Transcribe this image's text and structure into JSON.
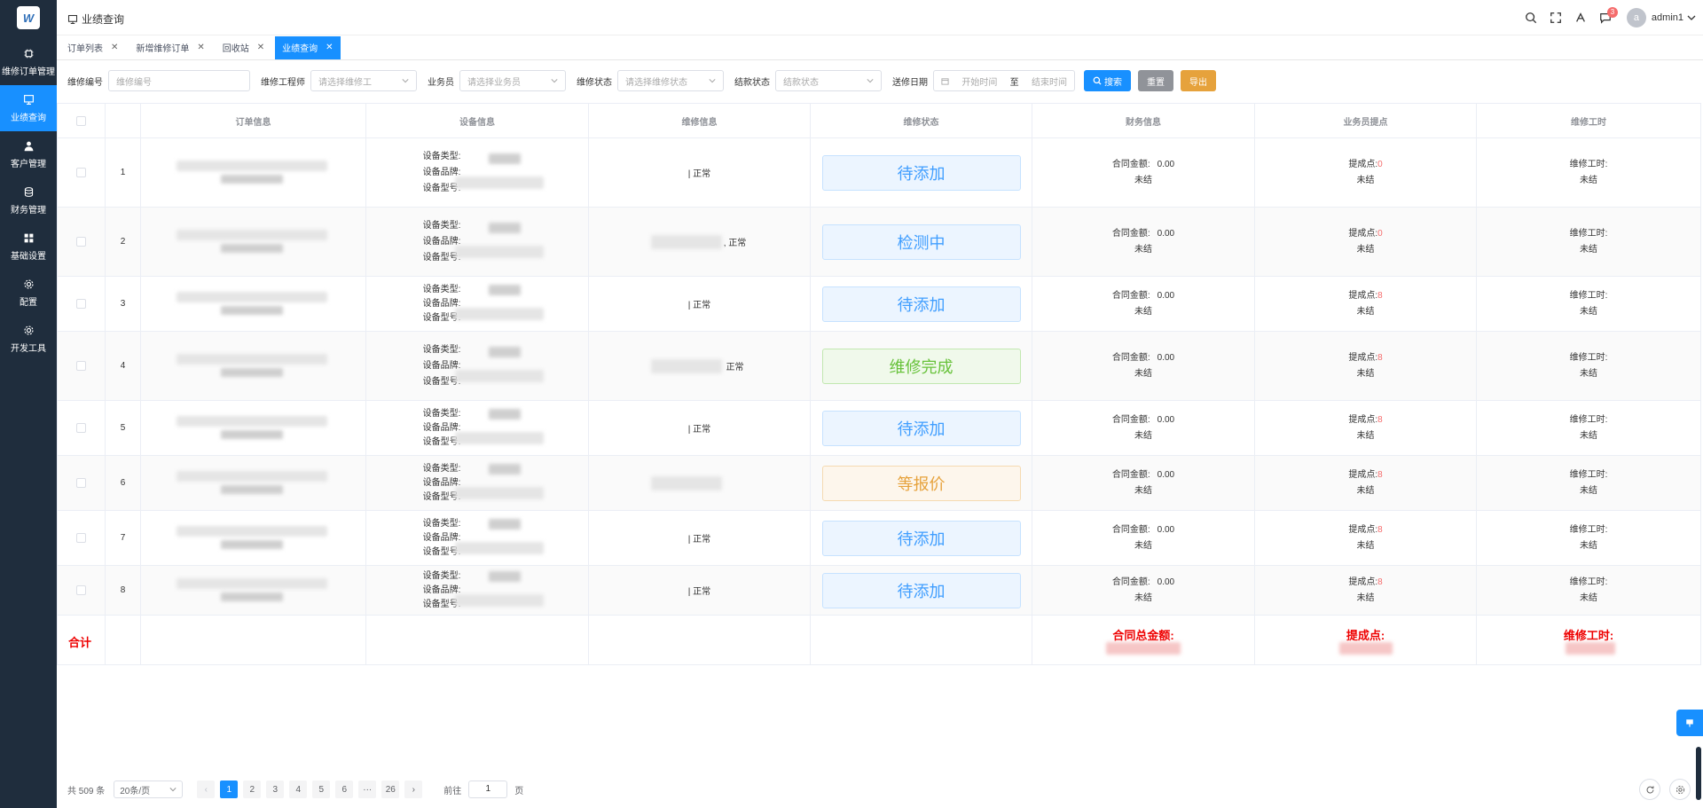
{
  "app": {
    "logo_letter": "W"
  },
  "sidebar": {
    "items": [
      {
        "label": "维修订单管理",
        "icon": "cpu-icon",
        "active": false
      },
      {
        "label": "业绩查询",
        "icon": "monitor-icon",
        "active": true
      },
      {
        "label": "客户管理",
        "icon": "user-icon",
        "active": false
      },
      {
        "label": "财务管理",
        "icon": "database-icon",
        "active": false
      },
      {
        "label": "基础设置",
        "icon": "grid-icon",
        "active": false
      },
      {
        "label": "配置",
        "icon": "gear-icon",
        "active": false
      },
      {
        "label": "开发工具",
        "icon": "gear-icon",
        "active": false
      }
    ]
  },
  "header": {
    "breadcrumb": "业绩查询",
    "notification_count": "3",
    "avatar_letter": "a",
    "username": "admin1"
  },
  "tabs": [
    {
      "label": "订单列表",
      "active": false
    },
    {
      "label": "新增维修订单",
      "active": false
    },
    {
      "label": "回收站",
      "active": false
    },
    {
      "label": "业绩查询",
      "active": true
    }
  ],
  "filters": {
    "repair_no_label": "维修编号",
    "repair_no_placeholder": "维修编号",
    "engineer_label": "维修工程师",
    "engineer_placeholder": "请选择维修工",
    "salesman_label": "业务员",
    "salesman_placeholder": "请选择业务员",
    "repair_status_label": "维修状态",
    "repair_status_placeholder": "请选择维修状态",
    "settle_status_label": "结款状态",
    "settle_status_placeholder": "结款状态",
    "date_label": "送修日期",
    "date_start": "开始时间",
    "date_sep": "至",
    "date_end": "结束时间",
    "search_btn": "搜索",
    "reset_btn": "重置",
    "export_btn": "导出"
  },
  "table": {
    "headers": [
      "订单信息",
      "设备信息",
      "维修信息",
      "维修状态",
      "财务信息",
      "业务员提点",
      "维修工时"
    ],
    "device_labels": {
      "type": "设备类型:",
      "brand": "设备品牌:",
      "model": "设备型号:"
    },
    "finance_label": "合同金额:",
    "commission_label": "提成点:",
    "hours_label": "维修工时:",
    "unsettled": "未结",
    "rows": [
      {
        "no": "1",
        "repair": "| 正常",
        "status": "待添加",
        "status_type": "blue",
        "amount": "0.00",
        "commission": "0"
      },
      {
        "no": "2",
        "repair": ", 正常",
        "status": "检测中",
        "status_type": "blue",
        "amount": "0.00",
        "commission": "0"
      },
      {
        "no": "3",
        "repair": "| 正常",
        "status": "待添加",
        "status_type": "blue",
        "amount": "0.00",
        "commission": "8"
      },
      {
        "no": "4",
        "repair": "正常",
        "status": "维修完成",
        "status_type": "green",
        "amount": "0.00",
        "commission": "8"
      },
      {
        "no": "5",
        "repair": "| 正常",
        "status": "待添加",
        "status_type": "blue",
        "amount": "0.00",
        "commission": "8"
      },
      {
        "no": "6",
        "repair": "",
        "status": "等报价",
        "status_type": "orange",
        "amount": "0.00",
        "commission": "8"
      },
      {
        "no": "7",
        "repair": "| 正常",
        "status": "待添加",
        "status_type": "blue",
        "amount": "0.00",
        "commission": "8"
      },
      {
        "no": "8",
        "repair": "| 正常",
        "status": "待添加",
        "status_type": "blue",
        "amount": "0.00",
        "commission": "8"
      }
    ],
    "total": {
      "label": "合计",
      "amount_label": "合同总金额:",
      "commission_label": "提成点:",
      "hours_label": "维修工时:"
    }
  },
  "pagination": {
    "total_text": "共 509 条",
    "page_size": "20条/页",
    "pages": [
      "1",
      "2",
      "3",
      "4",
      "5",
      "6",
      "···",
      "26"
    ],
    "current": "1",
    "goto_label": "前往",
    "goto_value": "1",
    "page_unit": "页"
  },
  "colors": {
    "accent": "#1890ff",
    "sidebar": "#1f2d3d",
    "danger": "#f56c6c"
  }
}
